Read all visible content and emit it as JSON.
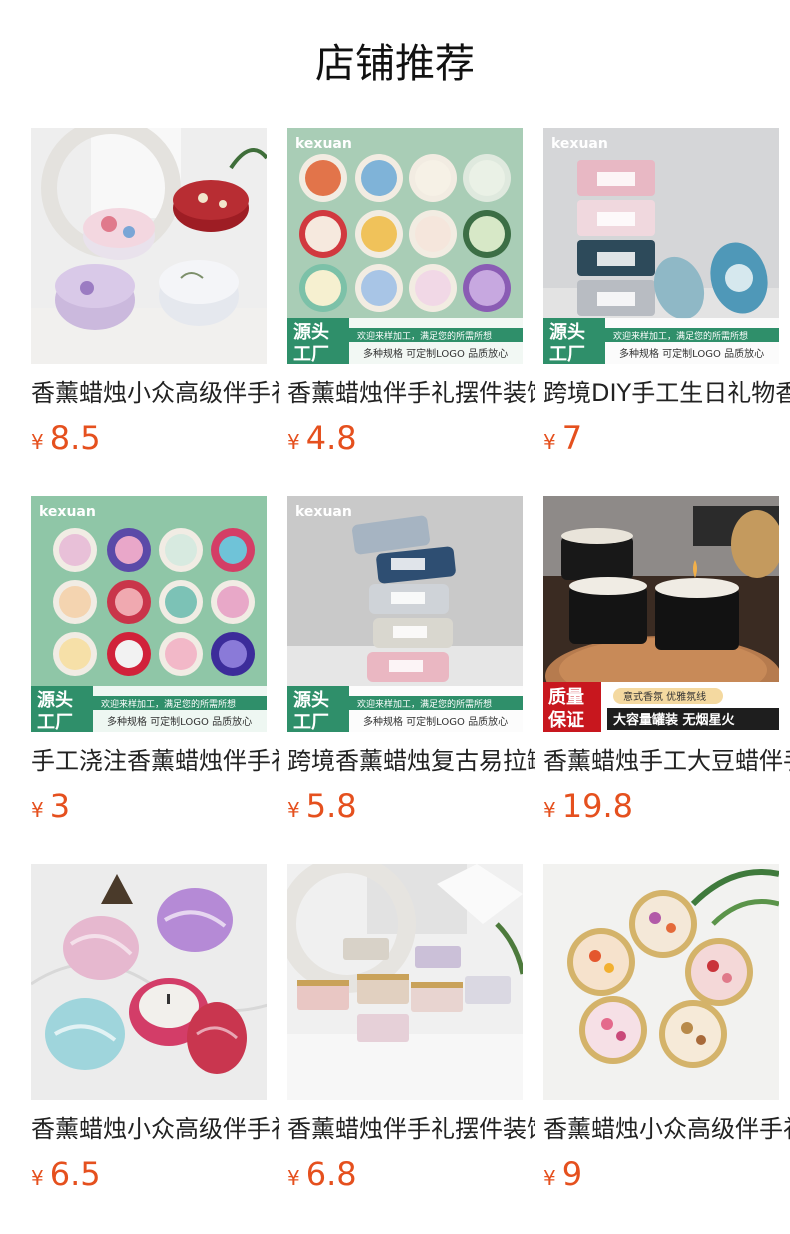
{
  "section": {
    "title": "店铺推荐"
  },
  "currency_symbol": "¥",
  "products": [
    {
      "title": "香薰蜡烛小众高级伴手礼",
      "price": "8.5",
      "image": "floral-tin-candles"
    },
    {
      "title": "香薰蜡烛伴手礼摆件装饰",
      "price": "4.8",
      "image": "pressed-flower-tin-candles-grid"
    },
    {
      "title": "跨境DIY手工生日礼物香薰",
      "price": "7",
      "image": "stacked-tin-candles"
    },
    {
      "title": "手工浇注香薰蜡烛伴手礼品",
      "price": "3",
      "image": "mandala-tin-candles-grid"
    },
    {
      "title": "跨境香薰蜡烛复古易拉罐",
      "price": "5.8",
      "image": "stacked-vintage-tin-candles"
    },
    {
      "title": "香薰蜡烛手工大豆蜡伴手礼",
      "price": "19.8",
      "image": "black-tin-candles-on-wood-tray"
    },
    {
      "title": "香薰蜡烛小众高级伴手礼",
      "price": "6.5",
      "image": "marble-tin-candles"
    },
    {
      "title": "香薰蜡烛伴手礼摆件装饰",
      "price": "6.8",
      "image": "open-tin-candles-set"
    },
    {
      "title": "香薰蜡烛小众高级伴手礼",
      "price": "9",
      "image": "dried-flower-candles"
    }
  ],
  "banners": {
    "brand": "kexuan",
    "source": "源头工厂",
    "source_line1": "源头",
    "source_line2": "工厂",
    "tagline1": "欢迎来样加工，满足您的所需所想",
    "tagline2": "多种规格 可定制LOGO 品质放心",
    "quality_line1": "质量",
    "quality_line2": "保证",
    "quality_tag": "意式香氛 优雅氛线",
    "quality_feature": "大容量罐装  无烟星火"
  },
  "colors": {
    "price": "#e5501e",
    "title": "#111111",
    "banner_green": "#2f8f6a",
    "banner_red": "#c8171e"
  }
}
